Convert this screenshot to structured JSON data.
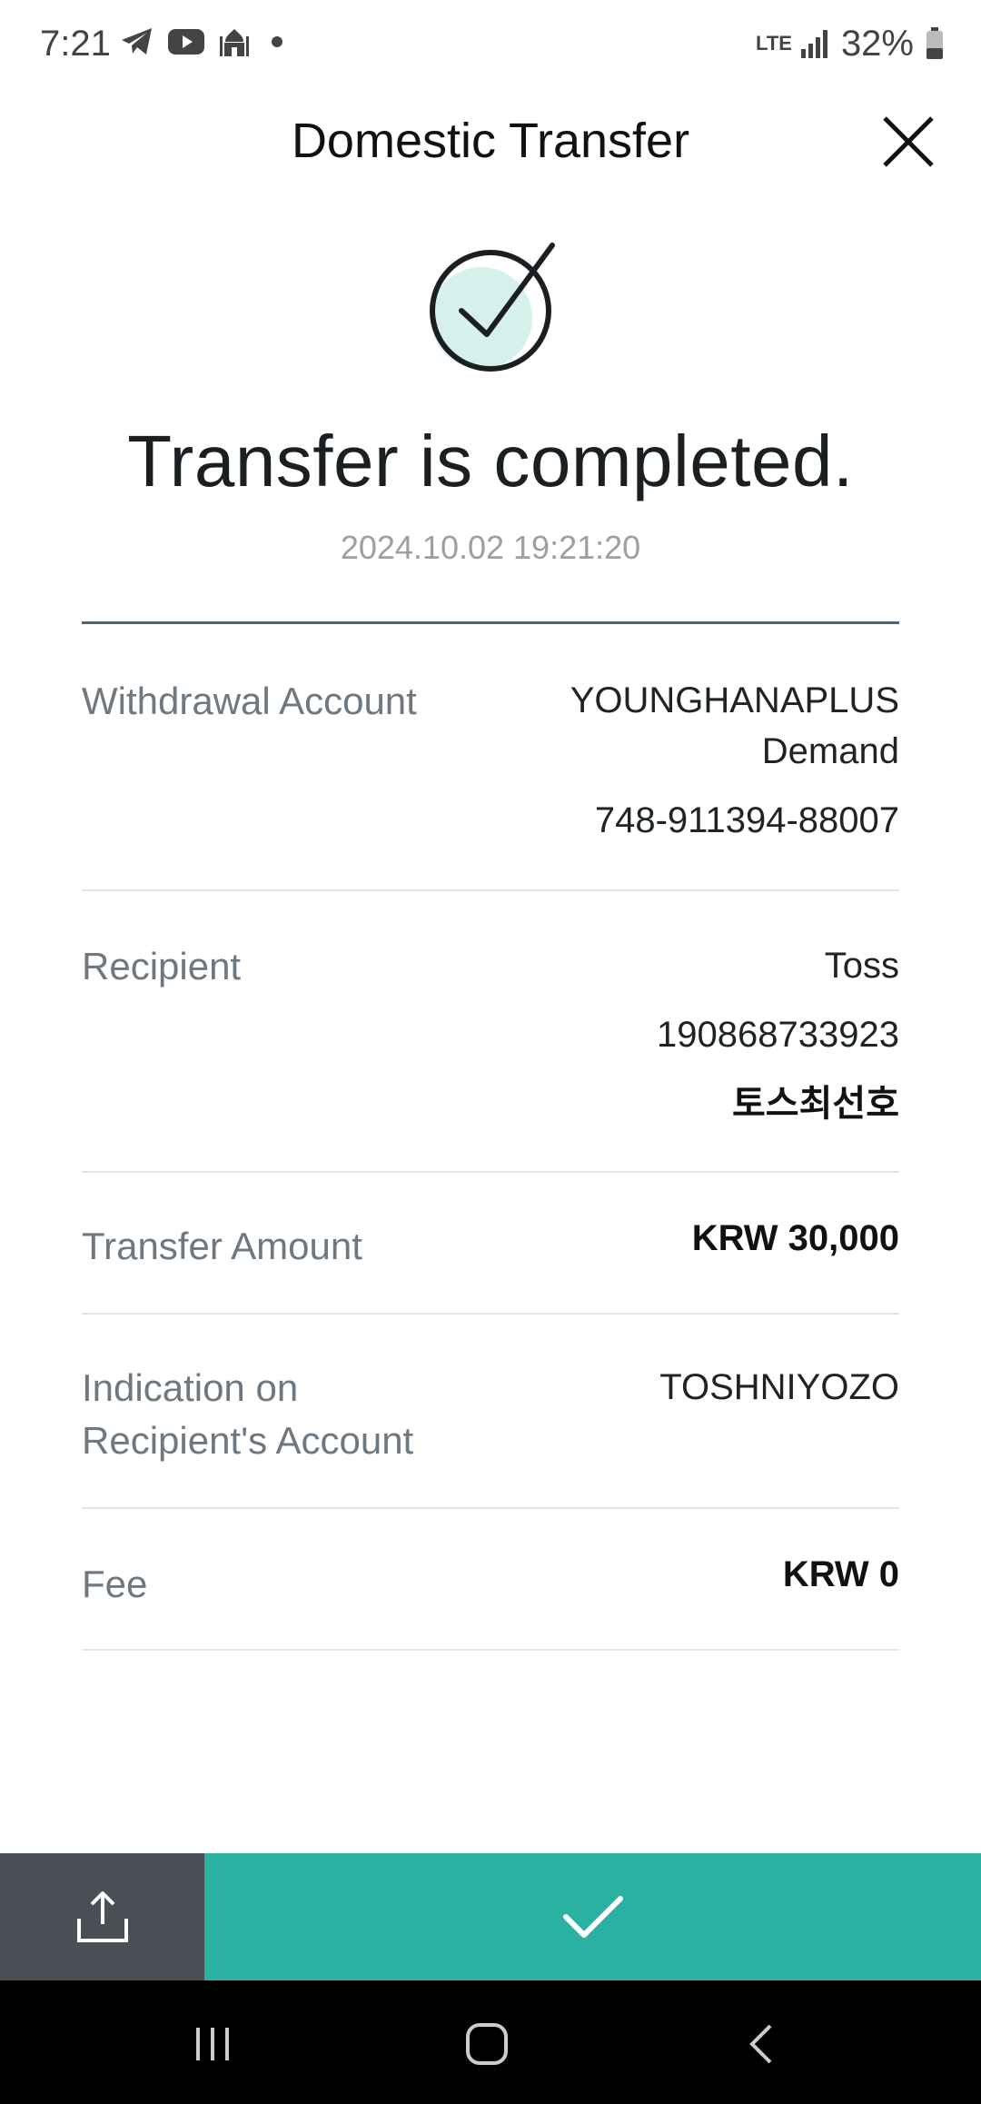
{
  "status_bar": {
    "time": "7:21",
    "battery": "32%",
    "network": "LTE",
    "icons": [
      "telegram-icon",
      "youtube-icon",
      "mosque-icon",
      "notification-dot-icon",
      "signal-icon",
      "battery-icon"
    ]
  },
  "header": {
    "title": "Domestic Transfer",
    "close_icon": "close-icon"
  },
  "result": {
    "icon": "check-circle-icon",
    "title": "Transfer is completed.",
    "timestamp": "2024.10.02 19:21:20"
  },
  "details": {
    "withdrawal": {
      "label": "Withdrawal Account",
      "name_line1": "YOUNGHANAPLUS",
      "name_line2": "Demand",
      "account_number": "748-911394-88007"
    },
    "recipient": {
      "label": "Recipient",
      "bank": "Toss",
      "account_number": "190868733923",
      "name": "토스최선호"
    },
    "amount": {
      "label": "Transfer Amount",
      "value": "KRW 30,000"
    },
    "indication": {
      "label_line1": "Indication on",
      "label_line2": "Recipient's Account",
      "value": "TOSHNIYOZO"
    },
    "fee": {
      "label": "Fee",
      "value": "KRW 0"
    }
  },
  "actions": {
    "share_icon": "share-icon",
    "confirm_icon": "checkmark-icon"
  },
  "colors": {
    "accent": "#2bb1a2",
    "share_bg": "#4a4f55",
    "check_fill": "#d6f0ec",
    "divider_strong": "#55606a",
    "divider": "#e3e6e8",
    "label": "#6d7880"
  }
}
